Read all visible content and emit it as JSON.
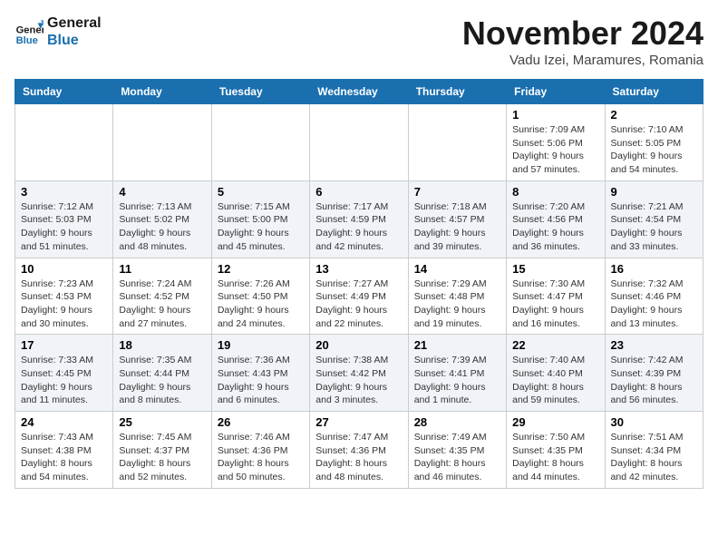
{
  "logo": {
    "line1": "General",
    "line2": "Blue"
  },
  "title": "November 2024",
  "location": "Vadu Izei, Maramures, Romania",
  "days_of_week": [
    "Sunday",
    "Monday",
    "Tuesday",
    "Wednesday",
    "Thursday",
    "Friday",
    "Saturday"
  ],
  "weeks": [
    [
      {
        "day": "",
        "info": ""
      },
      {
        "day": "",
        "info": ""
      },
      {
        "day": "",
        "info": ""
      },
      {
        "day": "",
        "info": ""
      },
      {
        "day": "",
        "info": ""
      },
      {
        "day": "1",
        "info": "Sunrise: 7:09 AM\nSunset: 5:06 PM\nDaylight: 9 hours and 57 minutes."
      },
      {
        "day": "2",
        "info": "Sunrise: 7:10 AM\nSunset: 5:05 PM\nDaylight: 9 hours and 54 minutes."
      }
    ],
    [
      {
        "day": "3",
        "info": "Sunrise: 7:12 AM\nSunset: 5:03 PM\nDaylight: 9 hours and 51 minutes."
      },
      {
        "day": "4",
        "info": "Sunrise: 7:13 AM\nSunset: 5:02 PM\nDaylight: 9 hours and 48 minutes."
      },
      {
        "day": "5",
        "info": "Sunrise: 7:15 AM\nSunset: 5:00 PM\nDaylight: 9 hours and 45 minutes."
      },
      {
        "day": "6",
        "info": "Sunrise: 7:17 AM\nSunset: 4:59 PM\nDaylight: 9 hours and 42 minutes."
      },
      {
        "day": "7",
        "info": "Sunrise: 7:18 AM\nSunset: 4:57 PM\nDaylight: 9 hours and 39 minutes."
      },
      {
        "day": "8",
        "info": "Sunrise: 7:20 AM\nSunset: 4:56 PM\nDaylight: 9 hours and 36 minutes."
      },
      {
        "day": "9",
        "info": "Sunrise: 7:21 AM\nSunset: 4:54 PM\nDaylight: 9 hours and 33 minutes."
      }
    ],
    [
      {
        "day": "10",
        "info": "Sunrise: 7:23 AM\nSunset: 4:53 PM\nDaylight: 9 hours and 30 minutes."
      },
      {
        "day": "11",
        "info": "Sunrise: 7:24 AM\nSunset: 4:52 PM\nDaylight: 9 hours and 27 minutes."
      },
      {
        "day": "12",
        "info": "Sunrise: 7:26 AM\nSunset: 4:50 PM\nDaylight: 9 hours and 24 minutes."
      },
      {
        "day": "13",
        "info": "Sunrise: 7:27 AM\nSunset: 4:49 PM\nDaylight: 9 hours and 22 minutes."
      },
      {
        "day": "14",
        "info": "Sunrise: 7:29 AM\nSunset: 4:48 PM\nDaylight: 9 hours and 19 minutes."
      },
      {
        "day": "15",
        "info": "Sunrise: 7:30 AM\nSunset: 4:47 PM\nDaylight: 9 hours and 16 minutes."
      },
      {
        "day": "16",
        "info": "Sunrise: 7:32 AM\nSunset: 4:46 PM\nDaylight: 9 hours and 13 minutes."
      }
    ],
    [
      {
        "day": "17",
        "info": "Sunrise: 7:33 AM\nSunset: 4:45 PM\nDaylight: 9 hours and 11 minutes."
      },
      {
        "day": "18",
        "info": "Sunrise: 7:35 AM\nSunset: 4:44 PM\nDaylight: 9 hours and 8 minutes."
      },
      {
        "day": "19",
        "info": "Sunrise: 7:36 AM\nSunset: 4:43 PM\nDaylight: 9 hours and 6 minutes."
      },
      {
        "day": "20",
        "info": "Sunrise: 7:38 AM\nSunset: 4:42 PM\nDaylight: 9 hours and 3 minutes."
      },
      {
        "day": "21",
        "info": "Sunrise: 7:39 AM\nSunset: 4:41 PM\nDaylight: 9 hours and 1 minute."
      },
      {
        "day": "22",
        "info": "Sunrise: 7:40 AM\nSunset: 4:40 PM\nDaylight: 8 hours and 59 minutes."
      },
      {
        "day": "23",
        "info": "Sunrise: 7:42 AM\nSunset: 4:39 PM\nDaylight: 8 hours and 56 minutes."
      }
    ],
    [
      {
        "day": "24",
        "info": "Sunrise: 7:43 AM\nSunset: 4:38 PM\nDaylight: 8 hours and 54 minutes."
      },
      {
        "day": "25",
        "info": "Sunrise: 7:45 AM\nSunset: 4:37 PM\nDaylight: 8 hours and 52 minutes."
      },
      {
        "day": "26",
        "info": "Sunrise: 7:46 AM\nSunset: 4:36 PM\nDaylight: 8 hours and 50 minutes."
      },
      {
        "day": "27",
        "info": "Sunrise: 7:47 AM\nSunset: 4:36 PM\nDaylight: 8 hours and 48 minutes."
      },
      {
        "day": "28",
        "info": "Sunrise: 7:49 AM\nSunset: 4:35 PM\nDaylight: 8 hours and 46 minutes."
      },
      {
        "day": "29",
        "info": "Sunrise: 7:50 AM\nSunset: 4:35 PM\nDaylight: 8 hours and 44 minutes."
      },
      {
        "day": "30",
        "info": "Sunrise: 7:51 AM\nSunset: 4:34 PM\nDaylight: 8 hours and 42 minutes."
      }
    ]
  ]
}
